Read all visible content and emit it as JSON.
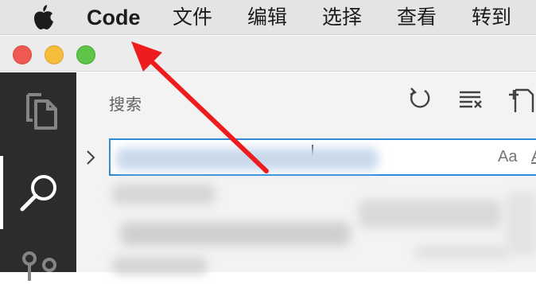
{
  "menubar": {
    "app_name": "Code",
    "items": [
      "文件",
      "编辑",
      "选择",
      "查看",
      "转到"
    ]
  },
  "window": {
    "traffic_lights": [
      "close",
      "minimize",
      "maximize"
    ]
  },
  "activitybar": {
    "items": [
      {
        "name": "files-icon"
      },
      {
        "name": "search-icon",
        "active": true
      },
      {
        "name": "source-control-icon"
      }
    ]
  },
  "sidebar": {
    "title": "搜索",
    "toolbar": [
      "refresh-icon",
      "clear-results-icon",
      "new-file-icon"
    ],
    "search": {
      "value": "",
      "placeholder": "",
      "match_case_label": "Aa",
      "whole_word_label": "A"
    }
  },
  "colors": {
    "menubar_bg": "#e5e4e4",
    "activitybar_bg": "#2c2c2c",
    "sidebar_bg": "#f3f3f3",
    "focus_border": "#2b8ad9",
    "annotation_arrow": "#ee1c1c"
  }
}
